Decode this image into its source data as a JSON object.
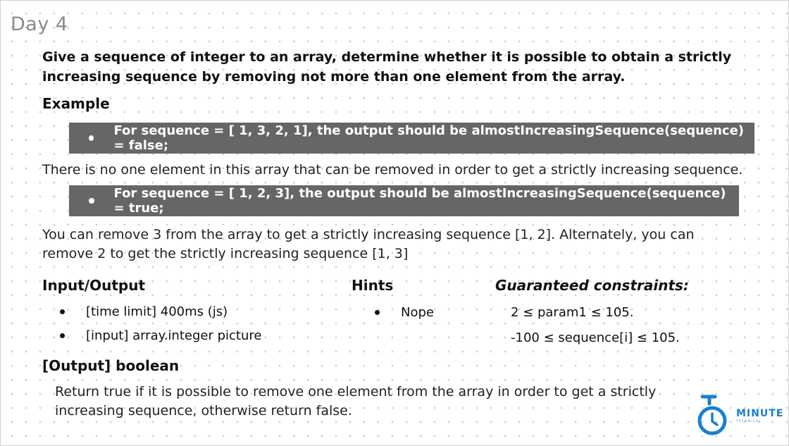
{
  "day_title": "Day 4",
  "problem": "Give a sequence of integer to an array, determine whether it is possible to obtain a strictly increasing sequence by removing not more than one element from the array.",
  "example": {
    "heading": "Example",
    "case1": "For sequence = [ 1, 3, 2, 1], the output should be almostIncreasingSequence(sequence) = false;",
    "explain1": "There is no one element in this array that can be removed in order to get a strictly increasing sequence.",
    "case2": "For sequence = [ 1, 2, 3], the output should be almostIncreasingSequence(sequence) = true;",
    "explain2_line1": "You can remove 3 from the array to get a strictly increasing sequence [1, 2]. Alternately, you can",
    "explain2_line2": "remove 2 to get the strictly increasing sequence [1, 3]"
  },
  "io": {
    "heading": "Input/Output",
    "items": [
      "[time limit] 400ms (js)",
      "[input] array.integer picture"
    ]
  },
  "hints": {
    "heading": "Hints",
    "items": [
      "Nope"
    ]
  },
  "constraints": {
    "heading": "Guaranteed constraints:",
    "items": [
      "2 ≤ param1 ≤ 105.",
      "-100 ≤ sequence[i] ≤ 105."
    ]
  },
  "output": {
    "heading": "[Output] boolean",
    "line1": "Return true if it is possible to remove one element from the array in order to get a strictly",
    "line2": "increasing sequence, otherwise return false."
  },
  "logo": {
    "word": "MINUTE",
    "sub": "TECHNICAL",
    "color": "#1a7fd0",
    "icon": "stopwatch-icon"
  },
  "colors": {
    "example_box": "#666666",
    "title_gray": "#8a8a8a"
  }
}
